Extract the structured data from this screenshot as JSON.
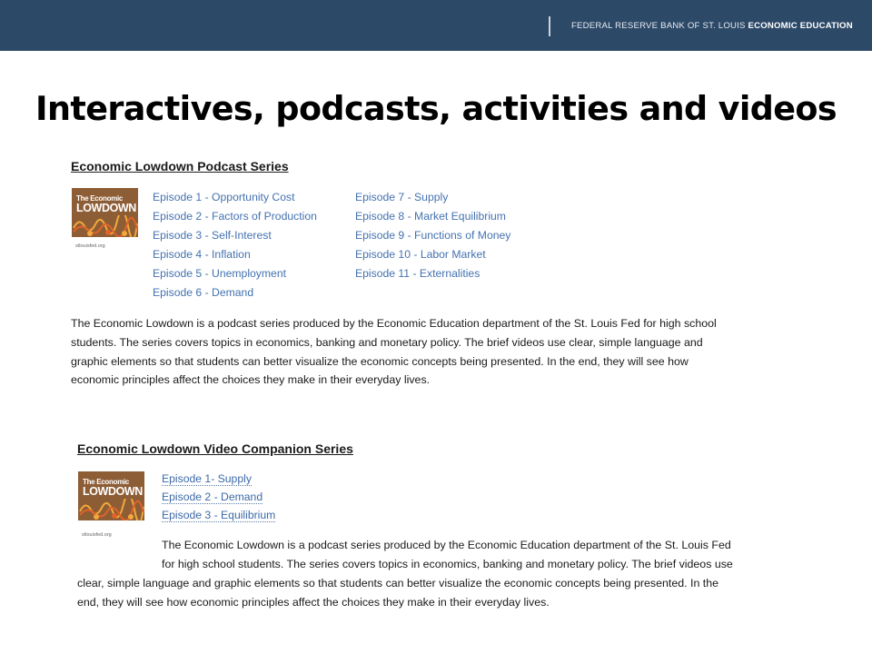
{
  "header": {
    "brand_prefix": "FEDERAL RESERVE BANK OF ST. LOUIS",
    "brand_suffix": "ECONOMIC EDUCATION",
    "bar_color": "#2d4968"
  },
  "slide": {
    "title": "Interactives, podcasts, activities and videos"
  },
  "podcast_series": {
    "heading": "Economic Lowdown Podcast Series",
    "logo": {
      "line1": "The Economic",
      "line2": "LOWDOWN",
      "caption": "stlouisfed.org"
    },
    "episodes_col1": [
      "Episode 1 - Opportunity Cost",
      "Episode 2 - Factors of Production",
      "Episode 3 - Self-Interest",
      "Episode 4 - Inflation",
      "Episode 5 - Unemployment",
      "Episode 6 - Demand"
    ],
    "episodes_col2": [
      "Episode 7 - Supply",
      "Episode 8 - Market Equilibrium",
      "Episode 9 - Functions of Money",
      "Episode 10 - Labor Market",
      "Episode 11 - Externalities"
    ],
    "description_lines": [
      "The Economic Lowdown is a podcast series produced by the Economic Education department of the St. Louis Fed for high school",
      "students. The series covers topics in economics, banking and monetary policy. The brief videos use clear, simple language and",
      "graphic elements so that students can better visualize the economic concepts being presented. In the end, they will see how",
      "economic principles affect the choices they make in their everyday lives."
    ]
  },
  "video_series": {
    "heading": "Economic Lowdown Video Companion Series",
    "logo": {
      "line1": "The Economic",
      "line2": "LOWDOWN",
      "caption": "stlouisfed.org"
    },
    "episodes": [
      "Episode 1- Supply",
      "Episode 2 - Demand",
      "Episode 3 - Equilibrium"
    ],
    "description_lines": [
      "The Economic Lowdown is a podcast series produced by the Economic Education department of the St. Louis Fed",
      "for high school students. The series covers topics in economics, banking and monetary policy. The brief videos use",
      "clear, simple language and graphic elements so that students can better visualize the economic concepts being presented. In the",
      "end, they will see how economic principles affect the choices they make in their everyday lives."
    ]
  }
}
